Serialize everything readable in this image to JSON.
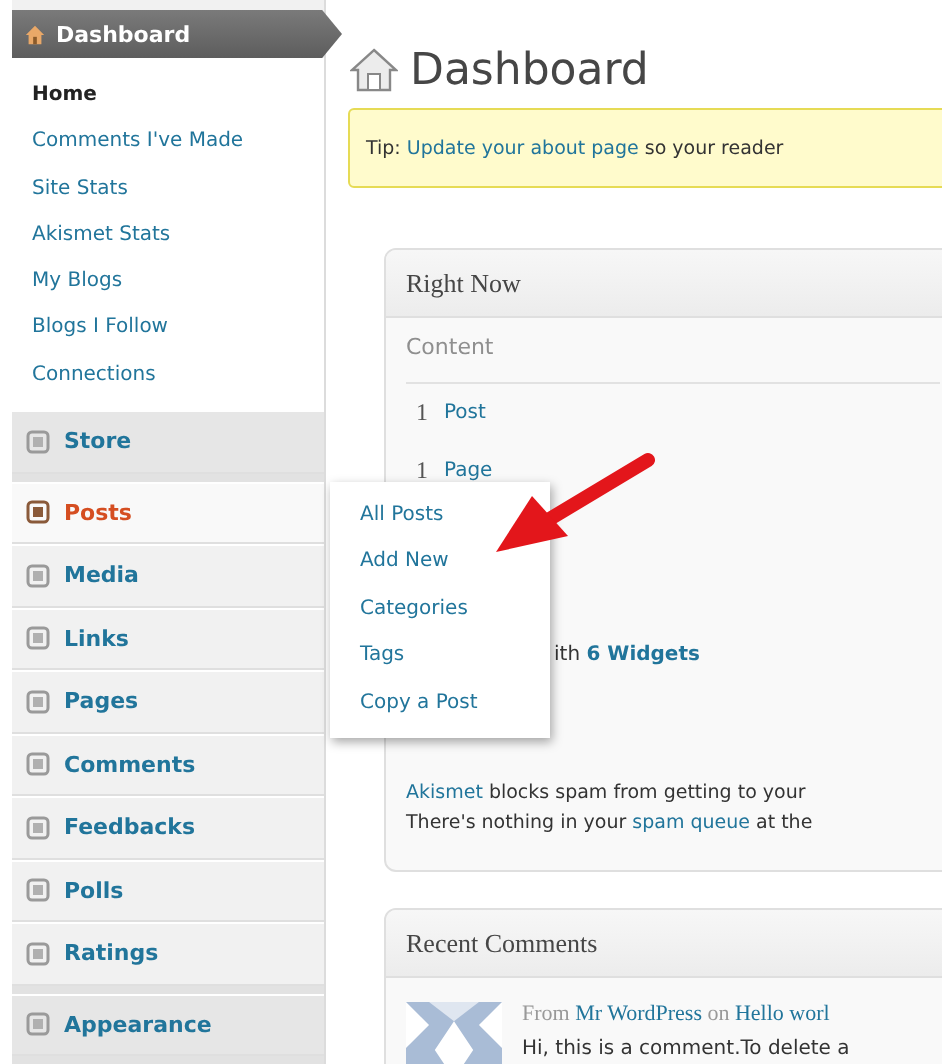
{
  "sidebar": {
    "header": {
      "label": "Dashboard",
      "selected": true
    },
    "submenu": [
      {
        "label": "Home",
        "selected": true
      },
      {
        "label": "Comments I've Made",
        "selected": false
      },
      {
        "label": "Site Stats",
        "selected": false
      },
      {
        "label": "Akismet Stats",
        "selected": false
      },
      {
        "label": "My Blogs",
        "selected": false
      },
      {
        "label": "Blogs I Follow",
        "selected": false
      },
      {
        "label": "Connections",
        "selected": false
      }
    ],
    "groups": [
      [
        {
          "label": "Store",
          "expanded": false
        }
      ],
      [
        {
          "label": "Posts",
          "expanded": true,
          "flyout": [
            "All Posts",
            "Add New",
            "Categories",
            "Tags",
            "Copy a Post"
          ]
        },
        {
          "label": "Media",
          "expanded": false
        },
        {
          "label": "Links",
          "expanded": false
        },
        {
          "label": "Pages",
          "expanded": false
        },
        {
          "label": "Comments",
          "expanded": false
        },
        {
          "label": "Feedbacks",
          "expanded": false
        },
        {
          "label": "Polls",
          "expanded": false
        },
        {
          "label": "Ratings",
          "expanded": false
        }
      ],
      [
        {
          "label": "Appearance",
          "expanded": false
        }
      ]
    ]
  },
  "page_title": "Dashboard",
  "tip": [
    {
      "text": "Tip: "
    },
    {
      "text": "Update your about page",
      "link": true
    },
    {
      "text": " so your reader"
    }
  ],
  "right_now": {
    "title": "Right Now",
    "heading": "Content",
    "rows": [
      {
        "count": "1",
        "label": "Post"
      },
      {
        "count": "1",
        "label": "Page"
      }
    ],
    "theme_line": [
      {
        "text": "ith "
      },
      {
        "text": "6 Widgets",
        "link": true
      }
    ],
    "spam_lines": [
      [
        {
          "text": "Akismet",
          "link": true
        },
        {
          "text": " blocks spam from getting to your"
        }
      ],
      [
        {
          "text": "There's nothing in your "
        },
        {
          "text": "spam queue",
          "link": true
        },
        {
          "text": " at the"
        }
      ]
    ]
  },
  "recent_comments": {
    "title": "Recent Comments",
    "meta": [
      {
        "text": "From "
      },
      {
        "text": "Mr WordPress",
        "link": true
      },
      {
        "text": " on "
      },
      {
        "text": "Hello worl",
        "link": true
      }
    ],
    "excerpt": "Hi, this is a comment.To delete a"
  }
}
